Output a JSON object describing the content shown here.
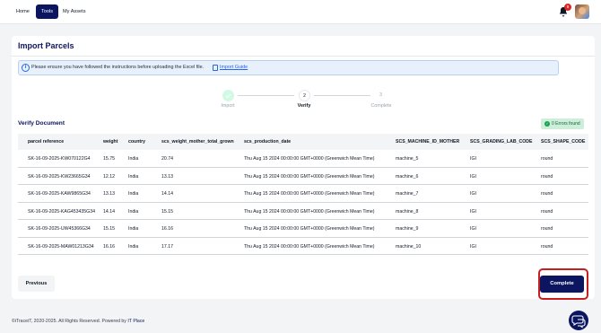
{
  "nav": {
    "items": [
      "Home",
      "Tools",
      "My Assets"
    ],
    "active": "Tools",
    "notification_count": "9"
  },
  "page": {
    "title": "Import Parcels",
    "info_text": "Please ensure you have followed the instructions before uploading the Excel file.",
    "guide_link": "Import Guide"
  },
  "stepper": {
    "steps": [
      {
        "number": "",
        "label": "Import",
        "state": "done"
      },
      {
        "number": "2",
        "label": "Verify",
        "state": "active"
      },
      {
        "number": "3",
        "label": "Complete",
        "state": "pending"
      }
    ]
  },
  "verify": {
    "title": "Verify Document",
    "errors_badge": "0 Errors found"
  },
  "table": {
    "headers": [
      "parcel reference",
      "weight",
      "country",
      "scs_weight_mother_total_grown",
      "scs_production_date",
      "SCS_MACHINE_ID_MOTHER",
      "SCS_GRADING_LAB_CODE",
      "SCS_SHAPE_CODE"
    ],
    "rows": [
      [
        "SK-16-09-2025-KW070122G4",
        "15.75",
        "India",
        "20.74",
        "Thu Aug 15 2024 00:00:00 GMT+0000 (Greenwich Mean Time)",
        "machine_5",
        "IGI",
        "round"
      ],
      [
        "SK-16-09-2025-KW23665G34",
        "12.12",
        "India",
        "13.13",
        "Thu Aug 15 2024 00:00:00 GMT+0000 (Greenwich Mean Time)",
        "machine_6",
        "IGI",
        "round"
      ],
      [
        "SK-16-09-2025-KAW9865G34",
        "13.13",
        "India",
        "14.14",
        "Thu Aug 15 2024 00:00:00 GMT+0000 (Greenwich Mean Time)",
        "machine_7",
        "IGI",
        "round"
      ],
      [
        "SK-16-09-2025-KAG453435G34",
        "14.14",
        "India",
        "15.15",
        "Thu Aug 15 2024 00:00:00 GMT+0000 (Greenwich Mean Time)",
        "machine_8",
        "IGI",
        "round"
      ],
      [
        "SK-16-09-2025-UW45366G34",
        "15.15",
        "India",
        "16.16",
        "Thu Aug 15 2024 00:00:00 GMT+0000 (Greenwich Mean Time)",
        "machine_9",
        "IGI",
        "round"
      ],
      [
        "SK-16-09-2025-MAW01213G34",
        "16.16",
        "India",
        "17.17",
        "Thu Aug 15 2024 00:00:00 GMT+0000 (Greenwich Mean Time)",
        "machine_10",
        "IGI",
        "round"
      ]
    ]
  },
  "actions": {
    "previous": "Previous",
    "complete": "Complete"
  },
  "footer": {
    "text": "©iTraceiT, 2020-2025. All Rights Reserved. Powered by",
    "brand": "IT Place"
  },
  "colors": {
    "primary": "#0b1560",
    "highlight_border": "#c81e1e",
    "info_bg": "#e8f1fb",
    "success_bg": "#cdeedb"
  },
  "icons": [
    "bell-icon",
    "avatar",
    "info-icon",
    "guide-icon",
    "check-icon",
    "chat-icon"
  ]
}
